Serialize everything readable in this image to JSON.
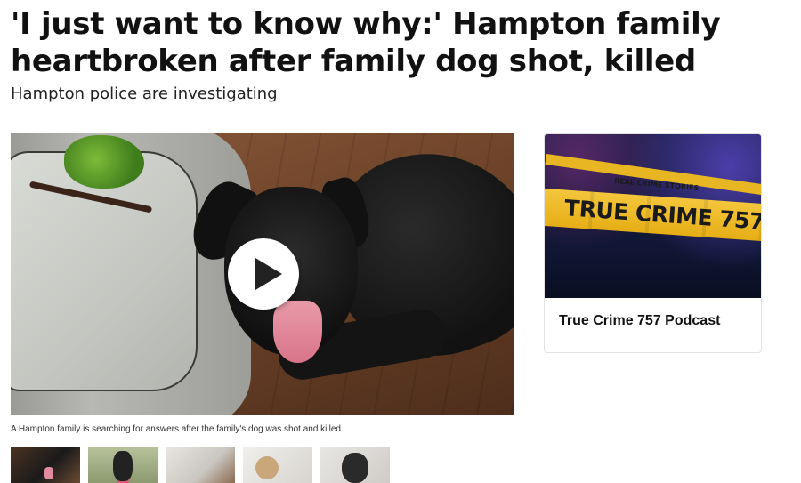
{
  "article": {
    "headline": "'I just want to know why:' Hampton family heartbroken after family dog shot, killed",
    "subheadline": "Hampton police are investigating"
  },
  "video": {
    "caption": "A Hampton family is searching for answers after the family's dog was shot and killed.",
    "play_icon": "play-icon"
  },
  "gallery": {
    "thumbnails": [
      "thumbnail-1",
      "thumbnail-2",
      "thumbnail-3",
      "thumbnail-4",
      "thumbnail-5"
    ]
  },
  "sidebar": {
    "podcast_card": {
      "art_kicker": "REAL CRIME STORIES",
      "art_title": "TRUE CRIME 757",
      "title": "True Crime 757 Podcast"
    }
  },
  "colors": {
    "tape_yellow": "#f4c63c",
    "art_background": "#1b1f4a",
    "text": "#111111"
  }
}
